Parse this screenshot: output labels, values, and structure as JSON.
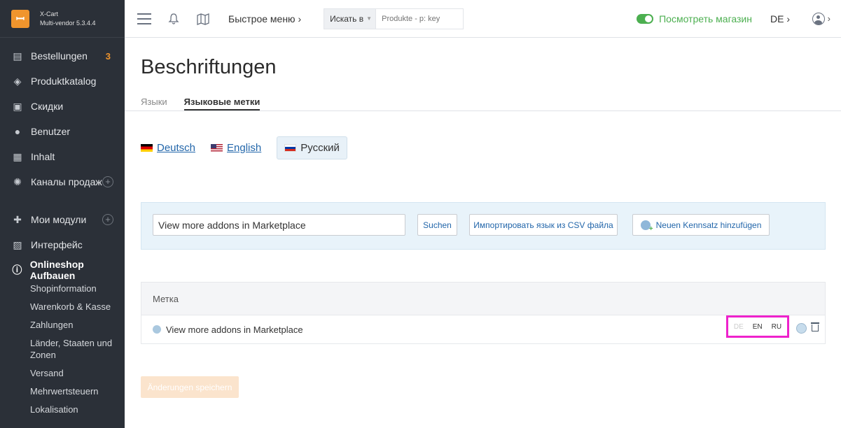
{
  "app": {
    "logo_name": "X-Cart",
    "logo_version": "Multi-vendor 5.3.4.4"
  },
  "sidebar": {
    "items": [
      {
        "label": "Bestellungen",
        "badge": "3",
        "icon": "orders-icon"
      },
      {
        "label": "Produktkatalog",
        "icon": "tag-icon"
      },
      {
        "label": "Скидки",
        "icon": "gift-icon"
      },
      {
        "label": "Benutzer",
        "icon": "users-icon"
      },
      {
        "label": "Inhalt",
        "icon": "content-icon"
      },
      {
        "label": "Каналы продаж",
        "icon": "sales-channels-icon",
        "plus": "+"
      },
      {
        "label": "Мои модули",
        "icon": "puzzle-icon",
        "plus": "+"
      },
      {
        "label": "Интерфейс",
        "icon": "image-icon"
      },
      {
        "label": "Onlineshop Aufbauen",
        "icon": "info-icon"
      }
    ],
    "sub_items": [
      "Shopinformation",
      "Warenkorb & Kasse",
      "Zahlungen",
      "Länder, Staaten und Zonen",
      "Versand",
      "Mehrwertsteuern",
      "Lokalisation"
    ]
  },
  "topbar": {
    "quick_menu": "Быстрое меню",
    "search_select": "Искать в",
    "search_placeholder": "Produkte - p: key",
    "view_store": "Посмотреть магазин",
    "language": "DE"
  },
  "main": {
    "title": "Beschriftungen",
    "tabs": [
      {
        "label": "Языки",
        "active": false
      },
      {
        "label": "Языковые метки",
        "active": true
      }
    ],
    "languages": [
      {
        "label": "Deutsch",
        "flag": "de"
      },
      {
        "label": "English",
        "flag": "us"
      },
      {
        "label": "Русский",
        "flag": "ru",
        "selected": true
      }
    ],
    "filter": {
      "search_value": "View more addons in Marketplace",
      "search_button": "Suchen",
      "import_button": "Импортировать язык из CSV файла",
      "add_button": "Neuen Kennsatz hinzufügen"
    },
    "table": {
      "header": "Метка",
      "rows": [
        {
          "label": "View more addons in Marketplace",
          "langs": [
            "DE",
            "EN",
            "RU"
          ]
        }
      ]
    },
    "save_button": "Änderungen speichern"
  },
  "colors": {
    "sidebar_bg": "#2b3038",
    "accent_orange": "#f0952d",
    "link_blue": "#2266aa",
    "store_green": "#4caf50",
    "highlight_magenta": "#ee22cc"
  }
}
